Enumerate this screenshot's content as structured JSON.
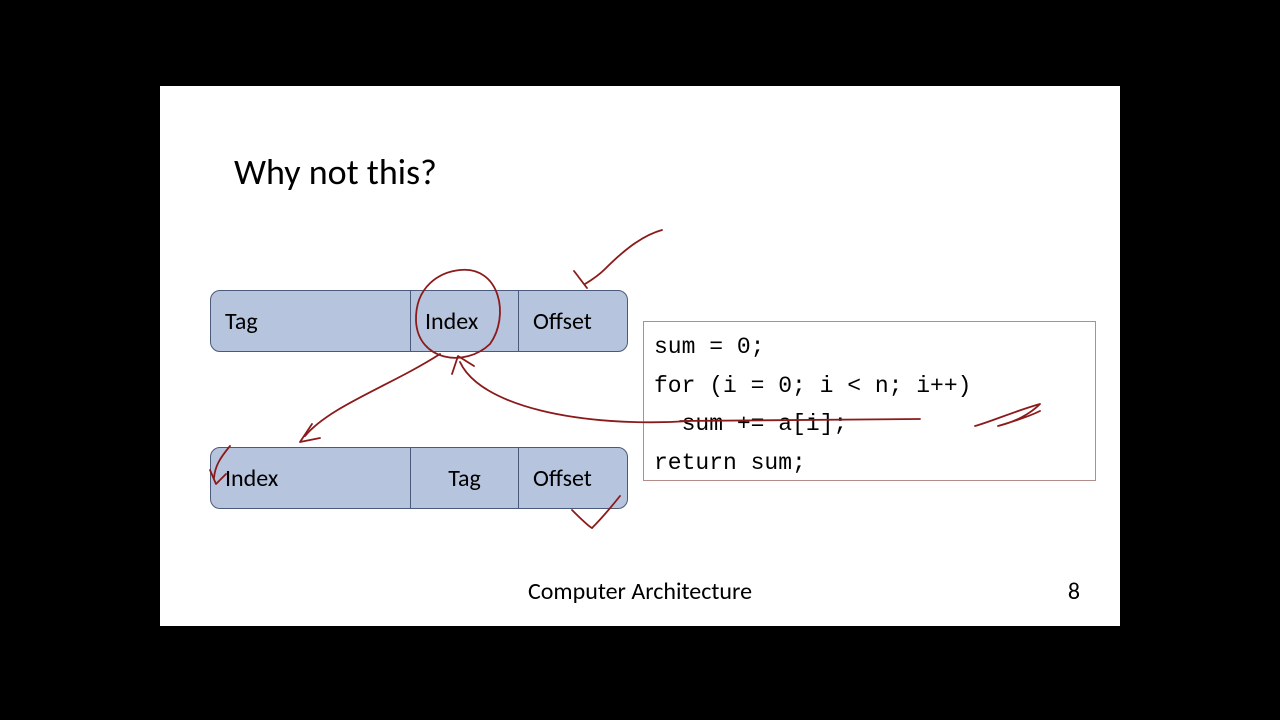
{
  "slide": {
    "title": "Why not this?",
    "footer_title": "Computer Architecture",
    "page_number": "8"
  },
  "addr_top": {
    "f1": "Tag",
    "f2": "Index",
    "f3": "Offset"
  },
  "addr_bottom": {
    "f1": "Index",
    "f2": "Tag",
    "f3": "Offset"
  },
  "code": {
    "line1": "sum = 0;",
    "line2": "for (i = 0; i < n; i++)",
    "line3": "  sum += a[i];",
    "line4": "return sum;"
  }
}
